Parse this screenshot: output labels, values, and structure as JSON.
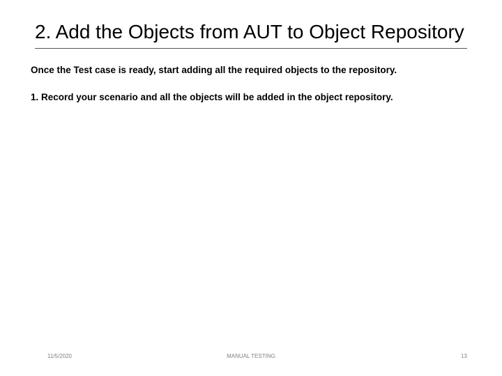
{
  "title": "2. Add the Objects from AUT to Object Repository",
  "intro": "Once the Test case is ready, start adding all the required objects to the repository.",
  "step1": "1. Record your scenario and all the objects will be added in the object repository.",
  "footer": {
    "date": "11/5/2020",
    "center": "MANUAL TESTING",
    "page": "13"
  }
}
